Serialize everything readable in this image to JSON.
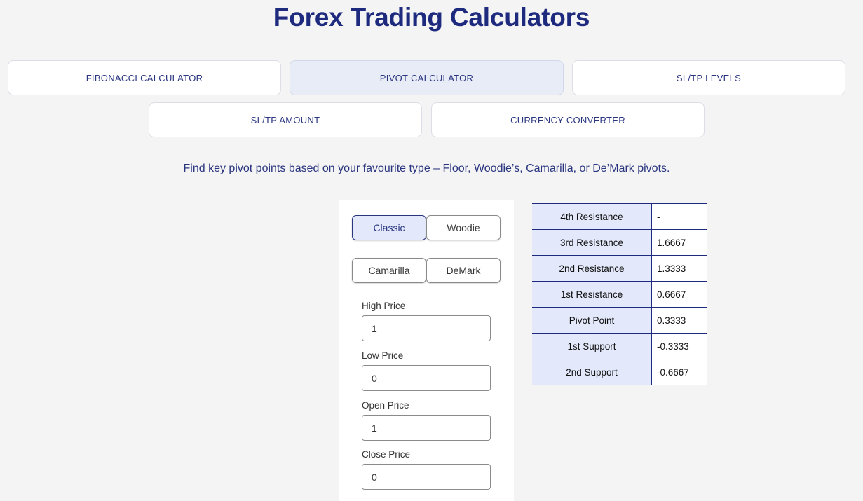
{
  "header": {
    "title": "Forex Trading Calculators"
  },
  "tabs": [
    {
      "label": "FIBONACCI CALCULATOR"
    },
    {
      "label": "PIVOT CALCULATOR"
    },
    {
      "label": "SL/TP LEVELS"
    },
    {
      "label": "SL/TP AMOUNT"
    },
    {
      "label": "CURRENCY CONVERTER"
    }
  ],
  "active_tab": "PIVOT CALCULATOR",
  "intro": "Find key pivot points based on your favourite type – Floor, Woodie’s, Camarilla, or De’Mark pivots.",
  "pivot_types": [
    {
      "label": "Classic"
    },
    {
      "label": "Woodie"
    },
    {
      "label": "Camarilla"
    },
    {
      "label": "DeMark"
    }
  ],
  "selected_type": "Classic",
  "fields": [
    {
      "label": "High Price",
      "value": "1"
    },
    {
      "label": "Low Price",
      "value": "0"
    },
    {
      "label": "Open Price",
      "value": "1"
    },
    {
      "label": "Close Price",
      "value": "0"
    }
  ],
  "results": [
    {
      "label": "4th Resistance",
      "value": "-"
    },
    {
      "label": "3rd Resistance",
      "value": "1.6667"
    },
    {
      "label": "2nd Resistance",
      "value": "1.3333"
    },
    {
      "label": "1st Resistance",
      "value": "0.6667"
    },
    {
      "label": "Pivot Point",
      "value": "0.3333"
    },
    {
      "label": "1st Support",
      "value": "-0.3333"
    },
    {
      "label": "2nd Support",
      "value": "-0.6667"
    }
  ],
  "colors": {
    "brand_navy": "#1e2a7e",
    "active_fill": "#e3e9fb",
    "page_background": "#f4f4f4"
  }
}
